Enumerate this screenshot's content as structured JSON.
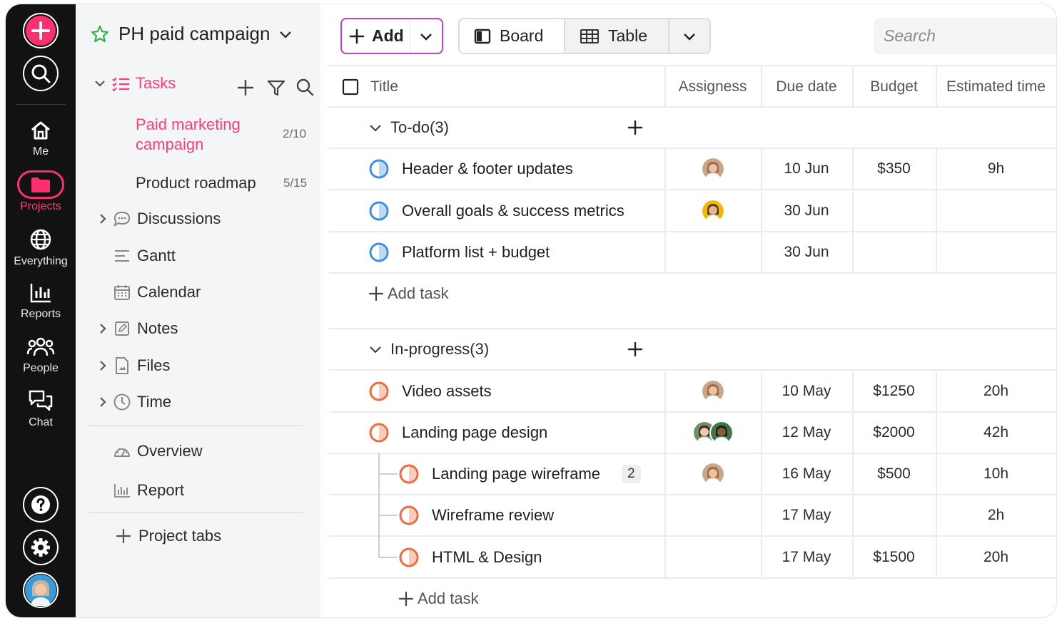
{
  "rail": {
    "items": [
      {
        "name": "me",
        "label": "Me"
      },
      {
        "name": "projects",
        "label": "Projects"
      },
      {
        "name": "everything",
        "label": "Everything"
      },
      {
        "name": "reports",
        "label": "Reports"
      },
      {
        "name": "people",
        "label": "People"
      },
      {
        "name": "chat",
        "label": "Chat"
      }
    ]
  },
  "project": {
    "title": "PH paid campaign",
    "tasks_label": "Tasks",
    "task_lists": [
      {
        "name": "Paid marketing campaign",
        "line1": "Paid marketing",
        "line2": "campaign",
        "count": "2/10"
      },
      {
        "name": "Product roadmap",
        "count": "5/15"
      }
    ],
    "nav": [
      {
        "label": "Discussions"
      },
      {
        "label": "Gantt"
      },
      {
        "label": "Calendar"
      },
      {
        "label": "Notes"
      },
      {
        "label": "Files"
      },
      {
        "label": "Time"
      },
      {
        "label": "Overview"
      },
      {
        "label": "Report"
      },
      {
        "label": "Project tabs"
      }
    ]
  },
  "toolbar": {
    "add_label": "Add",
    "board_label": "Board",
    "table_label": "Table",
    "search_placeholder": "Search"
  },
  "table": {
    "columns": [
      "Title",
      "Assigness",
      "Due date",
      "Budget",
      "Estimated time"
    ],
    "add_task_label": "Add task",
    "groups": [
      {
        "title": "To-do(3)",
        "status_color": "#3b8fe6",
        "tasks": [
          {
            "title": "Header & footer updates",
            "due": "10 Jun",
            "budget": "$350",
            "estimate": "9h"
          },
          {
            "title": "Overall goals & success metrics",
            "due": "30 Jun",
            "budget": "",
            "estimate": ""
          },
          {
            "title": "Platform list + budget",
            "due": "30 Jun",
            "budget": "",
            "estimate": ""
          }
        ]
      },
      {
        "title": "In-progress(3)",
        "status_color": "#f06a3a",
        "tasks": [
          {
            "title": "Video assets",
            "due": "10 May",
            "budget": "$1250",
            "estimate": "20h"
          },
          {
            "title": "Landing page design",
            "due": "12 May",
            "budget": "$2000",
            "estimate": "42h"
          },
          {
            "title": "Landing page wireframe",
            "badge": "2",
            "due": "16 May",
            "budget": "$500",
            "estimate": "10h"
          },
          {
            "title": "Wireframe review",
            "due": "17 May",
            "budget": "",
            "estimate": "2h"
          },
          {
            "title": "HTML & Design",
            "due": "17 May",
            "budget": "$1500",
            "estimate": "20h"
          }
        ]
      }
    ]
  },
  "colors": {
    "accent_pink": "#ff3b7a",
    "add_border": "#c63bd1",
    "rail_bg": "#121212",
    "todo_blue": "#3b8fe6",
    "progress_orange": "#f06a3a"
  }
}
